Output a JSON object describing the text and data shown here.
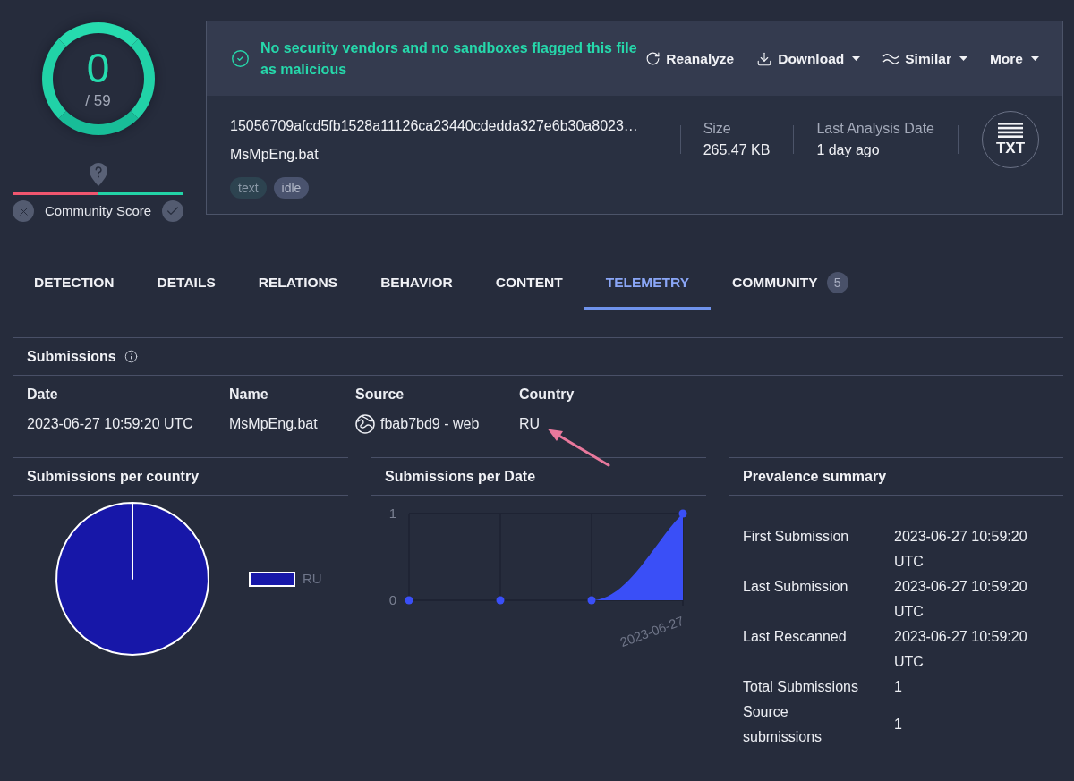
{
  "detection": {
    "count": "0",
    "total": "/ 59"
  },
  "community_score": {
    "label": "Community Score",
    "level": 0.5
  },
  "verdict": {
    "text": "No security vendors and no sandboxes flagged this file as malicious",
    "actions": [
      {
        "label": "Reanalyze",
        "kind": "reanalyze",
        "dropdown": false
      },
      {
        "label": "Download",
        "kind": "download",
        "dropdown": true
      },
      {
        "label": "Similar",
        "kind": "similar",
        "dropdown": true
      },
      {
        "label": "More",
        "kind": "more",
        "dropdown": true
      }
    ]
  },
  "file": {
    "hash": "15056709afcd5fb1528a11126ca23440cdedda327e6b30a8023…",
    "name": "MsMpEng.bat",
    "tags": [
      {
        "label": "text",
        "kind": "type"
      },
      {
        "label": "idle",
        "kind": "status"
      }
    ],
    "stats": [
      {
        "label": "Size",
        "value": "265.47 KB"
      },
      {
        "label": "Last Analysis Date",
        "value": "1 day ago"
      }
    ],
    "type_badge": "TXT"
  },
  "tabs": [
    {
      "label": "DETECTION",
      "selected": false
    },
    {
      "label": "DETAILS",
      "selected": false
    },
    {
      "label": "RELATIONS",
      "selected": false
    },
    {
      "label": "BEHAVIOR",
      "selected": false
    },
    {
      "label": "CONTENT",
      "selected": false
    },
    {
      "label": "TELEMETRY",
      "selected": true
    },
    {
      "label": "COMMUNITY",
      "selected": false,
      "badge": "5"
    }
  ],
  "submissions": {
    "title": "Submissions",
    "columns": [
      "Date",
      "Name",
      "Source",
      "Country"
    ],
    "rows": [
      {
        "date": "2023-06-27 10:59:20 UTC",
        "name": "MsMpEng.bat",
        "source": "fbab7bd9 - web",
        "country": "RU"
      }
    ]
  },
  "per_country": {
    "title": "Submissions per country",
    "legend": [
      {
        "label": "RU",
        "color": "#1717a8"
      }
    ]
  },
  "per_date": {
    "title": "Submissions per Date",
    "y_axis_labels": [
      "1",
      "0"
    ],
    "x_axis_label": "2023-06-27"
  },
  "prevalence": {
    "title": "Prevalence summary",
    "rows": [
      {
        "label": "First Submission",
        "value": "2023-06-27 10:59:20 UTC"
      },
      {
        "label": "Last Submission",
        "value": "2023-06-27 10:59:20 UTC"
      },
      {
        "label": "Last Rescanned",
        "value": "2023-06-27 10:59:20 UTC"
      },
      {
        "label": "Total Submissions",
        "value": "1"
      },
      {
        "label": "Source submissions",
        "value": "1"
      }
    ]
  }
}
